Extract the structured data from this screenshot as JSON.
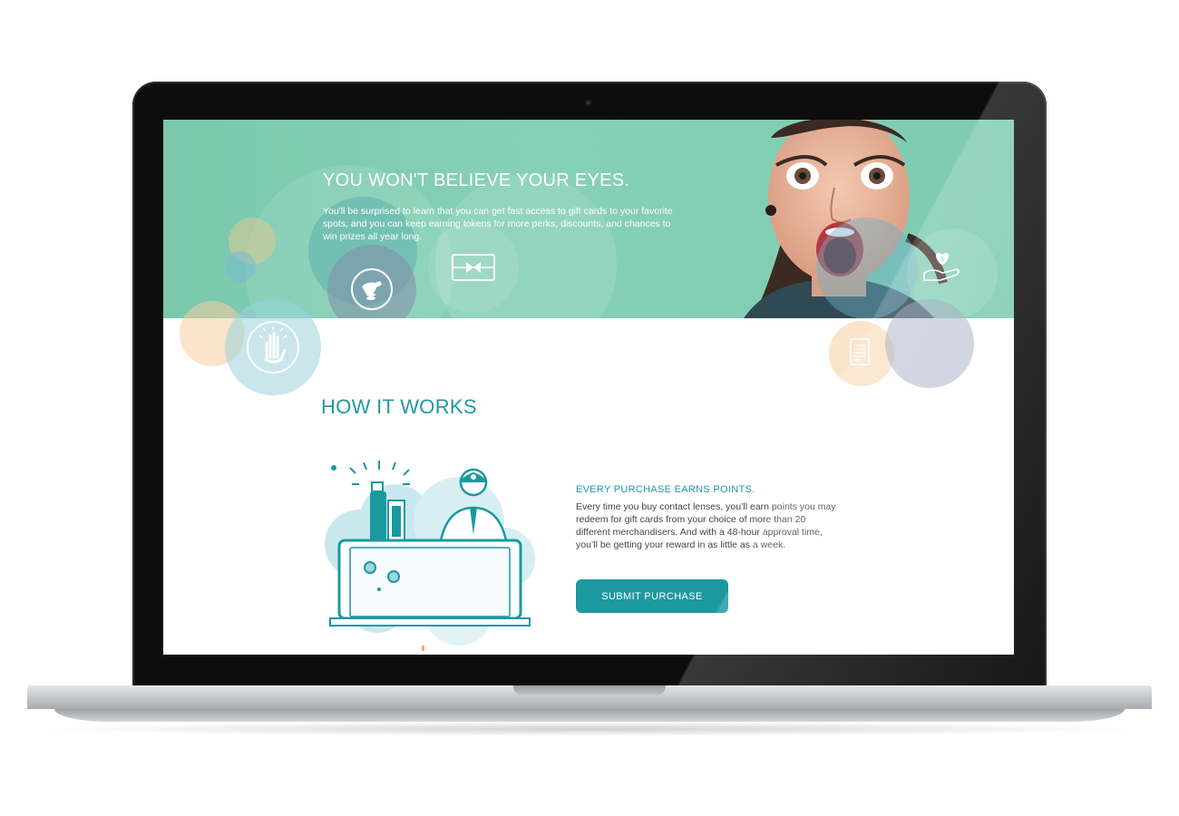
{
  "hero": {
    "title": "YOU WON'T BELIEVE YOUR EYES.",
    "body": "You'll be surprised to learn that you can get fast access to gift cards to your favorite spots, and you can keep earning tokens for more perks, discounts, and chances to win prizes all year long.",
    "icons": [
      "coin-hand-icon",
      "gift-card-icon",
      "raised-hand-icon",
      "heart-dollar-hand-icon",
      "receipt-icon"
    ]
  },
  "how_it_works": {
    "title": "HOW IT WORKS",
    "feature": {
      "title": "EVERY PURCHASE EARNS POINTS.",
      "body": "Every time you buy contact lenses, you’ll earn points you may redeem for gift cards from your choice of more than 20 different merchandisers. And with a 48-hour approval time, you’ll be getting your reward in as little as a week.",
      "button_label": "SUBMIT PURCHASE"
    }
  },
  "colors": {
    "hero_green": "#7ac9ad",
    "accent_teal": "#1c98a0",
    "text_gray": "#444444"
  }
}
